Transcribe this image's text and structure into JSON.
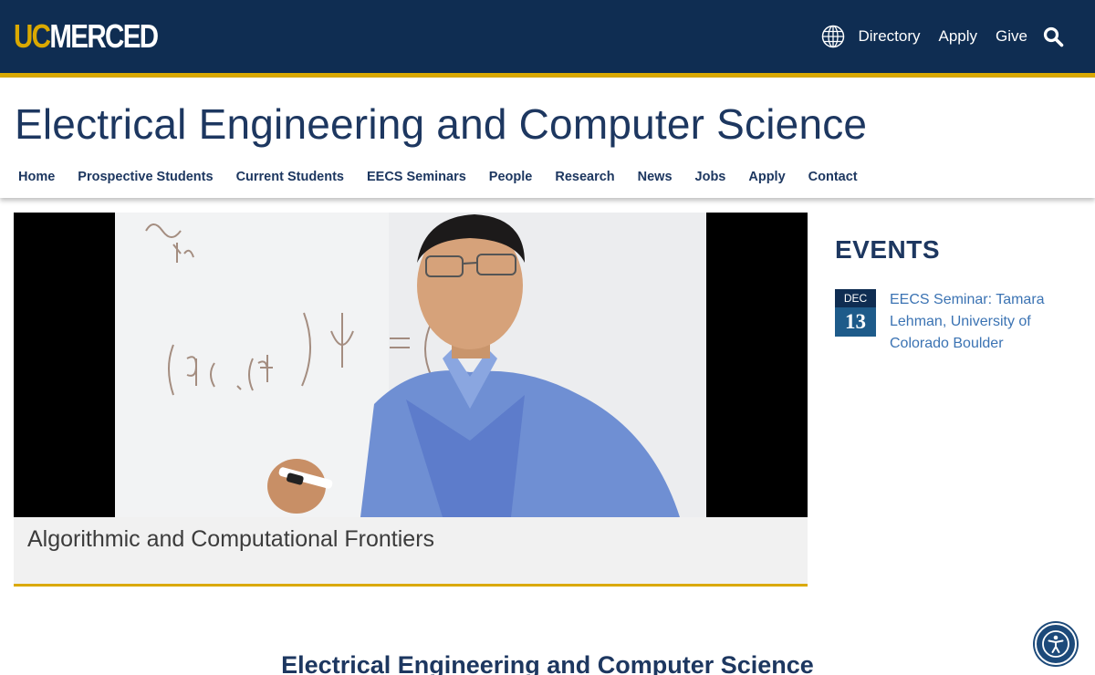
{
  "brand": {
    "logo_uc": "UC",
    "logo_merced": "MERCED",
    "gold": "#daa900",
    "navy": "#0f2d52"
  },
  "utility_nav": {
    "globe_icon": "globe-icon",
    "directory": "Directory",
    "apply": "Apply",
    "give": "Give",
    "search_icon": "search-icon"
  },
  "site": {
    "title": "Electrical Engineering and Computer Science"
  },
  "main_nav": {
    "items": [
      {
        "label": "Home"
      },
      {
        "label": "Prospective Students"
      },
      {
        "label": "Current Students"
      },
      {
        "label": "EECS Seminars"
      },
      {
        "label": "People"
      },
      {
        "label": "Research"
      },
      {
        "label": "News"
      },
      {
        "label": "Jobs"
      },
      {
        "label": "Apply"
      },
      {
        "label": "Contact"
      }
    ]
  },
  "hero": {
    "caption": "Algorithmic and Computational Frontiers"
  },
  "events": {
    "title": "EVENTS",
    "items": [
      {
        "month": "DEC",
        "day": "13",
        "title": "EECS Seminar: Tamara Lehman, University of Colorado Boulder"
      }
    ]
  },
  "content": {
    "heading": "Electrical Engineering and Computer Science"
  },
  "accessibility": {
    "icon": "accessibility-icon"
  }
}
